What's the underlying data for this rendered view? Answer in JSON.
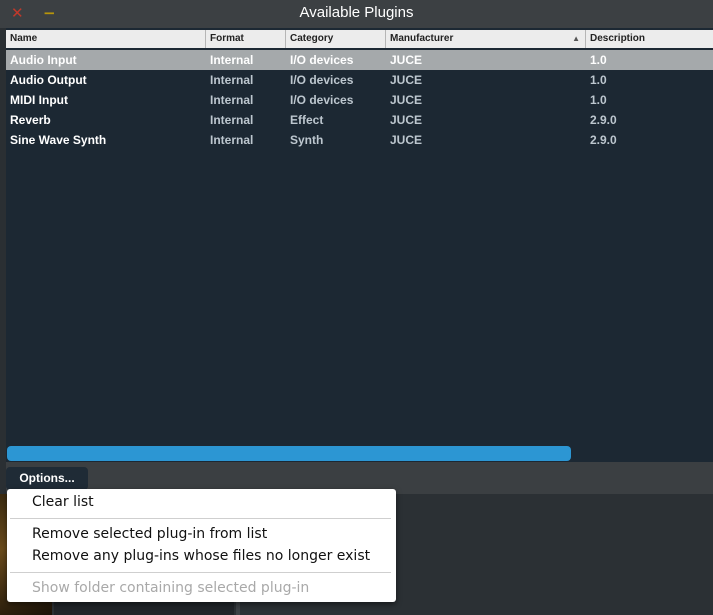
{
  "window": {
    "title": "Available Plugins"
  },
  "titlebar": {
    "close_glyph": "✕",
    "minimize_glyph": "−"
  },
  "table": {
    "columns": [
      "Name",
      "Format",
      "Category",
      "Manufacturer",
      "Description"
    ],
    "sort_column": "Manufacturer",
    "rows": [
      {
        "name": "Audio Input",
        "format": "Internal",
        "category": "I/O devices",
        "manufacturer": "JUCE",
        "description": "1.0",
        "selected": true
      },
      {
        "name": "Audio Output",
        "format": "Internal",
        "category": "I/O devices",
        "manufacturer": "JUCE",
        "description": "1.0",
        "selected": false
      },
      {
        "name": "MIDI Input",
        "format": "Internal",
        "category": "I/O devices",
        "manufacturer": "JUCE",
        "description": "1.0",
        "selected": false
      },
      {
        "name": "Reverb",
        "format": "Internal",
        "category": "Effect",
        "manufacturer": "JUCE",
        "description": "2.9.0",
        "selected": false
      },
      {
        "name": "Sine Wave Synth",
        "format": "Internal",
        "category": "Synth",
        "manufacturer": "JUCE",
        "description": "2.9.0",
        "selected": false
      }
    ]
  },
  "options_button": {
    "label": "Options..."
  },
  "menu": {
    "items": [
      {
        "label": "Clear list",
        "enabled": true
      },
      {
        "label": "Remove selected plug-in from list",
        "enabled": true
      },
      {
        "label": "Remove any plug-ins whose files no longer exist",
        "enabled": true
      },
      {
        "label": "Show folder containing selected plug-in",
        "enabled": false
      }
    ]
  },
  "colors": {
    "background": "#1c2833",
    "selected_row": "#a5a9ab",
    "progress": "#2c96d3",
    "close": "#c0392b",
    "minimize": "#b7950b"
  }
}
